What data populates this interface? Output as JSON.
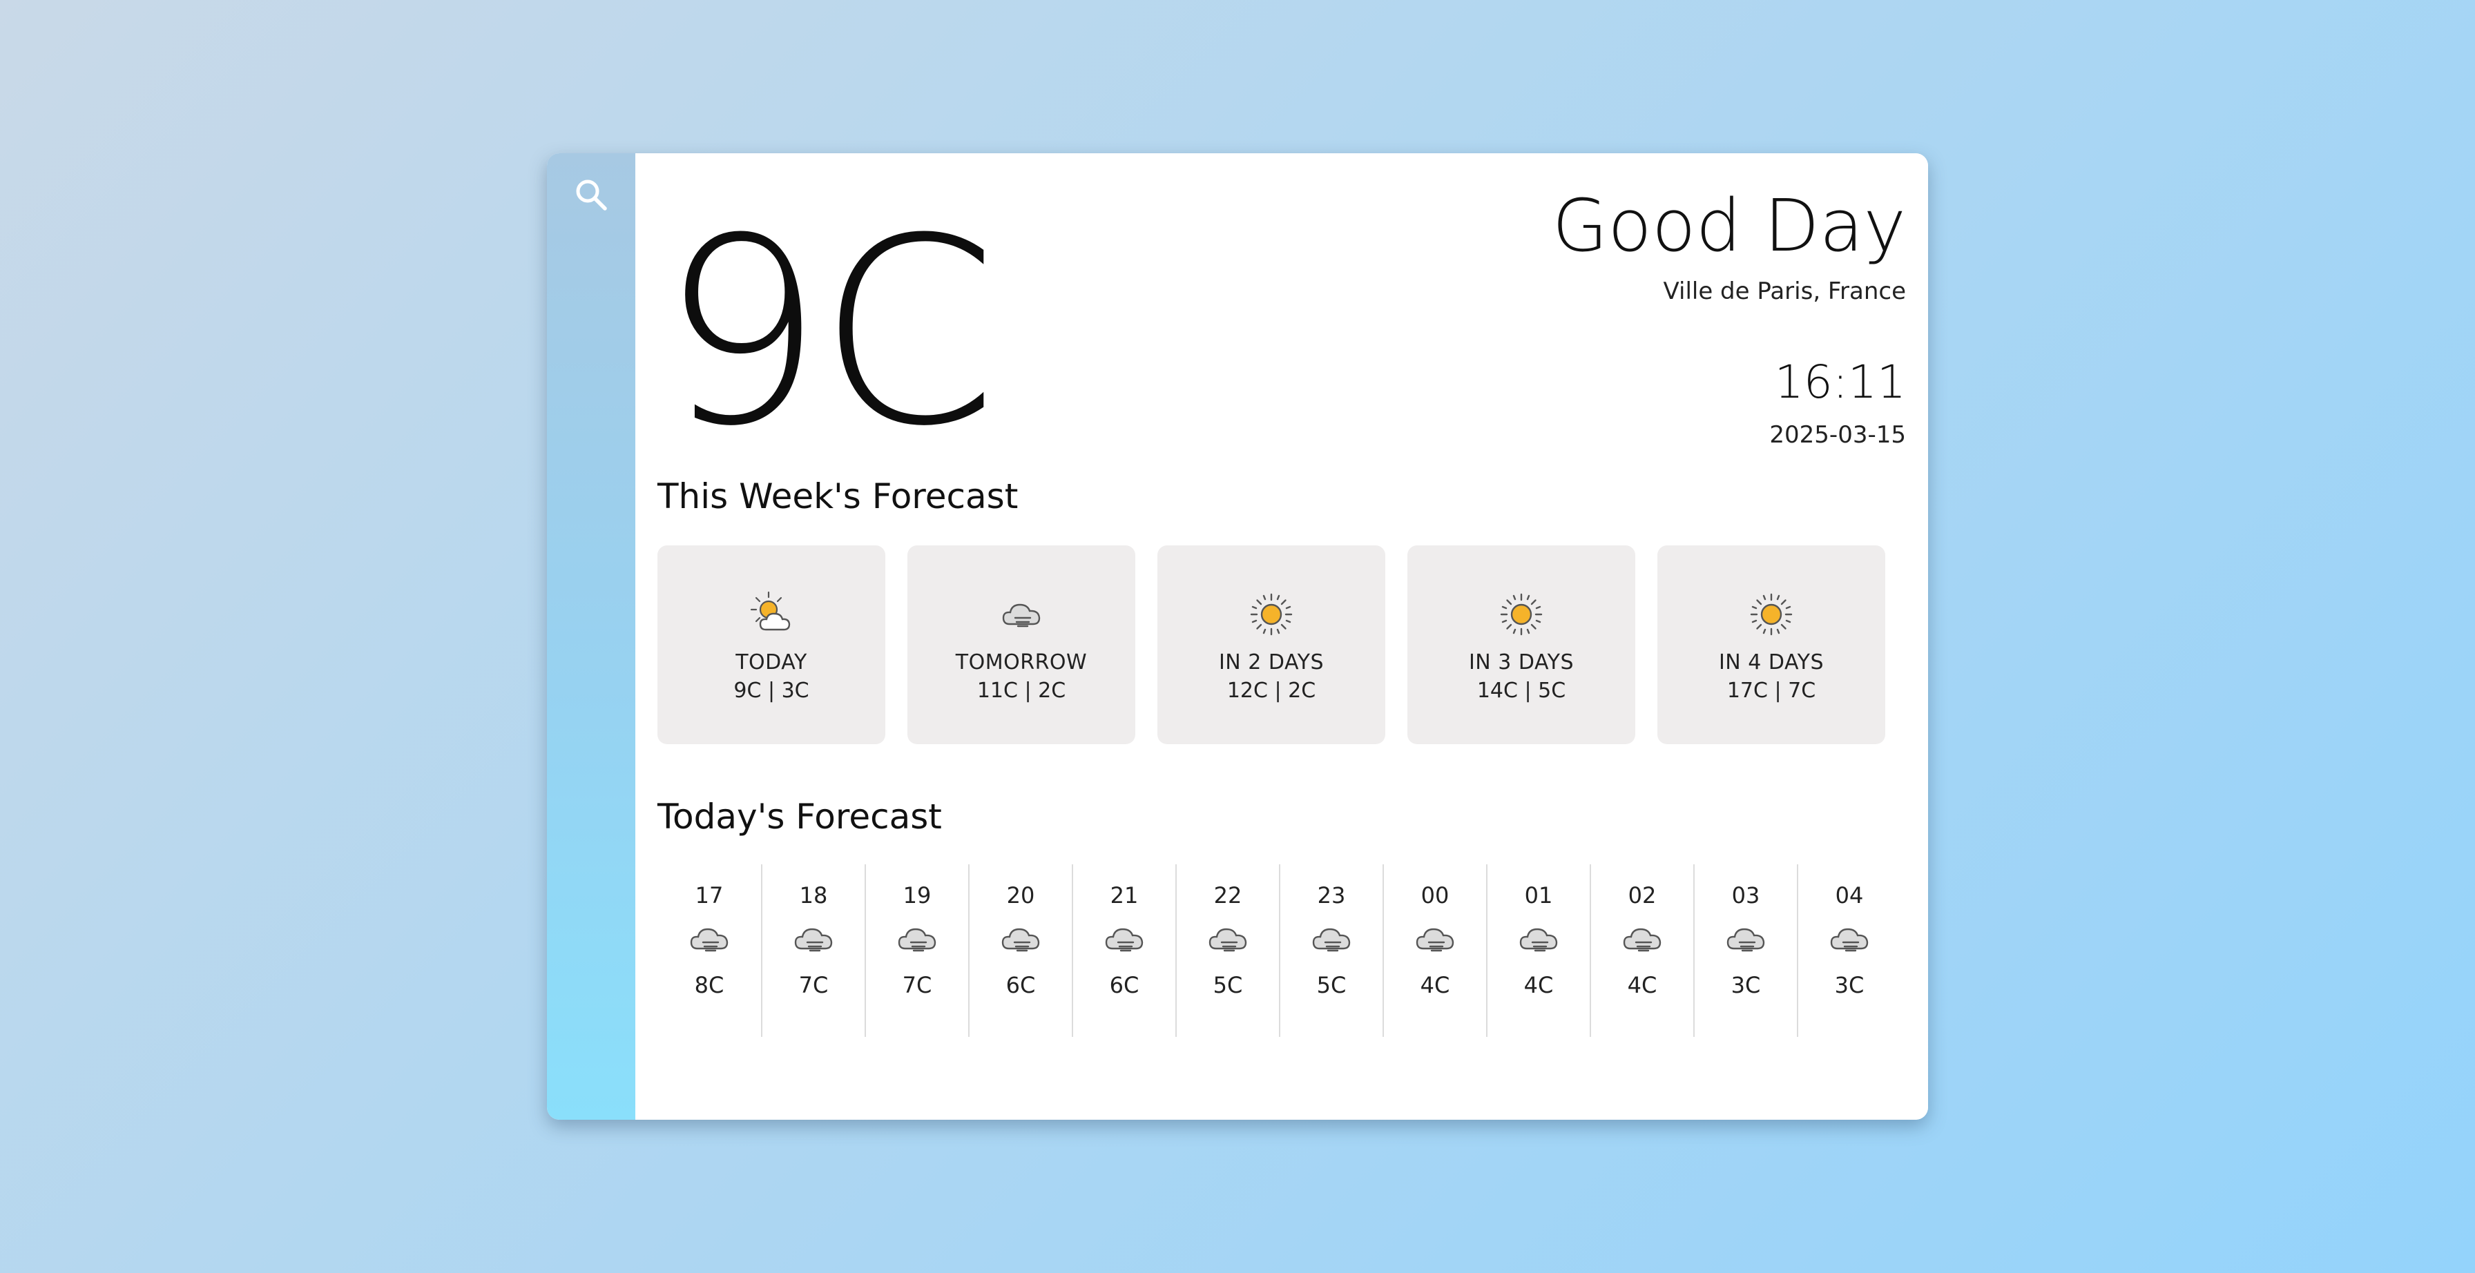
{
  "current": {
    "temperature": "9C",
    "greeting": "Good Day",
    "location": "Ville de Paris, France",
    "time": "16:11",
    "date": "2025-03-15"
  },
  "sidebar": {
    "search_icon": "search-icon"
  },
  "week": {
    "title": "This Week's Forecast",
    "days": [
      {
        "label": "TODAY",
        "temps": "9C | 3C",
        "icon": "partly-sunny-icon"
      },
      {
        "label": "TOMORROW",
        "temps": "11C | 2C",
        "icon": "fog-cloud-icon"
      },
      {
        "label": "IN 2 DAYS",
        "temps": "12C | 2C",
        "icon": "sun-icon"
      },
      {
        "label": "IN 3 DAYS",
        "temps": "14C | 5C",
        "icon": "sun-icon"
      },
      {
        "label": "IN 4 DAYS",
        "temps": "17C | 7C",
        "icon": "sun-icon"
      }
    ]
  },
  "today": {
    "title": "Today's Forecast",
    "hours": [
      {
        "hour": "17",
        "temp": "8C",
        "icon": "fog-cloud-icon"
      },
      {
        "hour": "18",
        "temp": "7C",
        "icon": "fog-cloud-icon"
      },
      {
        "hour": "19",
        "temp": "7C",
        "icon": "fog-cloud-icon"
      },
      {
        "hour": "20",
        "temp": "6C",
        "icon": "fog-cloud-icon"
      },
      {
        "hour": "21",
        "temp": "6C",
        "icon": "fog-cloud-icon"
      },
      {
        "hour": "22",
        "temp": "5C",
        "icon": "fog-cloud-icon"
      },
      {
        "hour": "23",
        "temp": "5C",
        "icon": "fog-cloud-icon"
      },
      {
        "hour": "00",
        "temp": "4C",
        "icon": "fog-cloud-icon"
      },
      {
        "hour": "01",
        "temp": "4C",
        "icon": "fog-cloud-icon"
      },
      {
        "hour": "02",
        "temp": "4C",
        "icon": "fog-cloud-icon"
      },
      {
        "hour": "03",
        "temp": "3C",
        "icon": "fog-cloud-icon"
      },
      {
        "hour": "04",
        "temp": "3C",
        "icon": "fog-cloud-icon"
      }
    ]
  },
  "colors": {
    "sun": "#f5b32a",
    "cloud_stroke": "#555555",
    "card_bg": "#efeded"
  }
}
